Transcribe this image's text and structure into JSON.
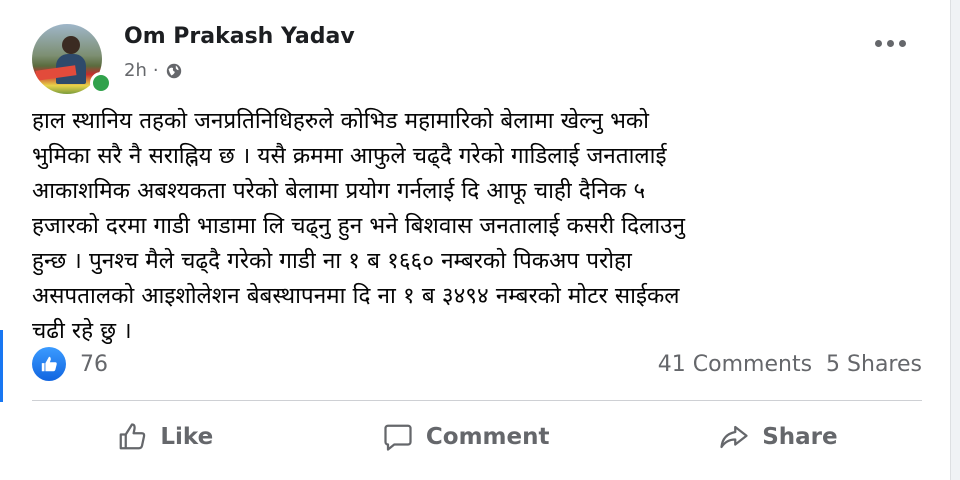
{
  "post": {
    "author": "Om Prakash Yadav",
    "time": "2h",
    "privacy_icon": "globe-icon",
    "more_icon": "more-options-icon",
    "text": "हाल स्थानिय तहको जनप्रतिनिधिहरुले कोभिड महामारिको बेलामा खेल्नु भको\nभुमिका सरै नै सराह्निय छ । यसै क्रममा आफुले चढ्दै गरेको गाडिलाई जनतालाई\nआकाशमिक अबश्यकता परेको बेलामा प्रयोग गर्नलाई दि आफू चाही दैनिक ५\nहजारको दरमा गाडी भाडामा लि चढ्नु हुन भने बिशवास जनतालाई कसरी दिलाउनु\nहुन्छ । पुनश्च मैले चढ्दै गरेको गाडी ना १ ब १६६० नम्बरको पिकअप परोहा\nअसपतालको आइशोलेशन बेबस्थापनमा दि ना १ ब ३४९४ नम्बरको मोटर साईकल\nचढी रहे छु ।"
  },
  "stats": {
    "likes": "76",
    "comments": "41 Comments",
    "shares": "5 Shares"
  },
  "actions": {
    "like": "Like",
    "comment": "Comment",
    "share": "Share"
  },
  "colors": {
    "accent": "#1877f2",
    "online": "#31a24c",
    "muted_text": "#65676b"
  }
}
